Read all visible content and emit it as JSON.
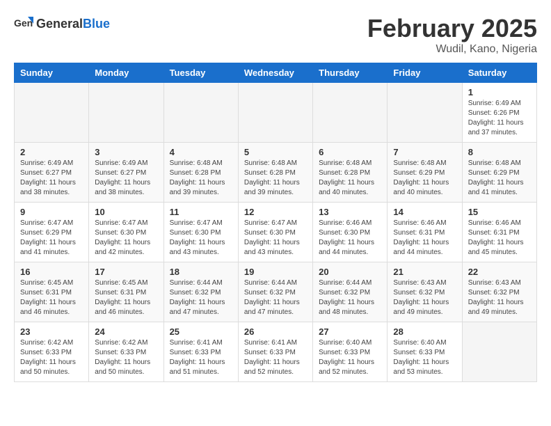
{
  "app": {
    "name_general": "General",
    "name_blue": "Blue"
  },
  "calendar": {
    "title": "February 2025",
    "subtitle": "Wudil, Kano, Nigeria",
    "weekdays": [
      "Sunday",
      "Monday",
      "Tuesday",
      "Wednesday",
      "Thursday",
      "Friday",
      "Saturday"
    ],
    "weeks": [
      [
        {
          "day": "",
          "info": ""
        },
        {
          "day": "",
          "info": ""
        },
        {
          "day": "",
          "info": ""
        },
        {
          "day": "",
          "info": ""
        },
        {
          "day": "",
          "info": ""
        },
        {
          "day": "",
          "info": ""
        },
        {
          "day": "1",
          "info": "Sunrise: 6:49 AM\nSunset: 6:26 PM\nDaylight: 11 hours and 37 minutes."
        }
      ],
      [
        {
          "day": "2",
          "info": "Sunrise: 6:49 AM\nSunset: 6:27 PM\nDaylight: 11 hours and 38 minutes."
        },
        {
          "day": "3",
          "info": "Sunrise: 6:49 AM\nSunset: 6:27 PM\nDaylight: 11 hours and 38 minutes."
        },
        {
          "day": "4",
          "info": "Sunrise: 6:48 AM\nSunset: 6:28 PM\nDaylight: 11 hours and 39 minutes."
        },
        {
          "day": "5",
          "info": "Sunrise: 6:48 AM\nSunset: 6:28 PM\nDaylight: 11 hours and 39 minutes."
        },
        {
          "day": "6",
          "info": "Sunrise: 6:48 AM\nSunset: 6:28 PM\nDaylight: 11 hours and 40 minutes."
        },
        {
          "day": "7",
          "info": "Sunrise: 6:48 AM\nSunset: 6:29 PM\nDaylight: 11 hours and 40 minutes."
        },
        {
          "day": "8",
          "info": "Sunrise: 6:48 AM\nSunset: 6:29 PM\nDaylight: 11 hours and 41 minutes."
        }
      ],
      [
        {
          "day": "9",
          "info": "Sunrise: 6:47 AM\nSunset: 6:29 PM\nDaylight: 11 hours and 41 minutes."
        },
        {
          "day": "10",
          "info": "Sunrise: 6:47 AM\nSunset: 6:30 PM\nDaylight: 11 hours and 42 minutes."
        },
        {
          "day": "11",
          "info": "Sunrise: 6:47 AM\nSunset: 6:30 PM\nDaylight: 11 hours and 43 minutes."
        },
        {
          "day": "12",
          "info": "Sunrise: 6:47 AM\nSunset: 6:30 PM\nDaylight: 11 hours and 43 minutes."
        },
        {
          "day": "13",
          "info": "Sunrise: 6:46 AM\nSunset: 6:30 PM\nDaylight: 11 hours and 44 minutes."
        },
        {
          "day": "14",
          "info": "Sunrise: 6:46 AM\nSunset: 6:31 PM\nDaylight: 11 hours and 44 minutes."
        },
        {
          "day": "15",
          "info": "Sunrise: 6:46 AM\nSunset: 6:31 PM\nDaylight: 11 hours and 45 minutes."
        }
      ],
      [
        {
          "day": "16",
          "info": "Sunrise: 6:45 AM\nSunset: 6:31 PM\nDaylight: 11 hours and 46 minutes."
        },
        {
          "day": "17",
          "info": "Sunrise: 6:45 AM\nSunset: 6:31 PM\nDaylight: 11 hours and 46 minutes."
        },
        {
          "day": "18",
          "info": "Sunrise: 6:44 AM\nSunset: 6:32 PM\nDaylight: 11 hours and 47 minutes."
        },
        {
          "day": "19",
          "info": "Sunrise: 6:44 AM\nSunset: 6:32 PM\nDaylight: 11 hours and 47 minutes."
        },
        {
          "day": "20",
          "info": "Sunrise: 6:44 AM\nSunset: 6:32 PM\nDaylight: 11 hours and 48 minutes."
        },
        {
          "day": "21",
          "info": "Sunrise: 6:43 AM\nSunset: 6:32 PM\nDaylight: 11 hours and 49 minutes."
        },
        {
          "day": "22",
          "info": "Sunrise: 6:43 AM\nSunset: 6:32 PM\nDaylight: 11 hours and 49 minutes."
        }
      ],
      [
        {
          "day": "23",
          "info": "Sunrise: 6:42 AM\nSunset: 6:33 PM\nDaylight: 11 hours and 50 minutes."
        },
        {
          "day": "24",
          "info": "Sunrise: 6:42 AM\nSunset: 6:33 PM\nDaylight: 11 hours and 50 minutes."
        },
        {
          "day": "25",
          "info": "Sunrise: 6:41 AM\nSunset: 6:33 PM\nDaylight: 11 hours and 51 minutes."
        },
        {
          "day": "26",
          "info": "Sunrise: 6:41 AM\nSunset: 6:33 PM\nDaylight: 11 hours and 52 minutes."
        },
        {
          "day": "27",
          "info": "Sunrise: 6:40 AM\nSunset: 6:33 PM\nDaylight: 11 hours and 52 minutes."
        },
        {
          "day": "28",
          "info": "Sunrise: 6:40 AM\nSunset: 6:33 PM\nDaylight: 11 hours and 53 minutes."
        },
        {
          "day": "",
          "info": ""
        }
      ]
    ]
  }
}
